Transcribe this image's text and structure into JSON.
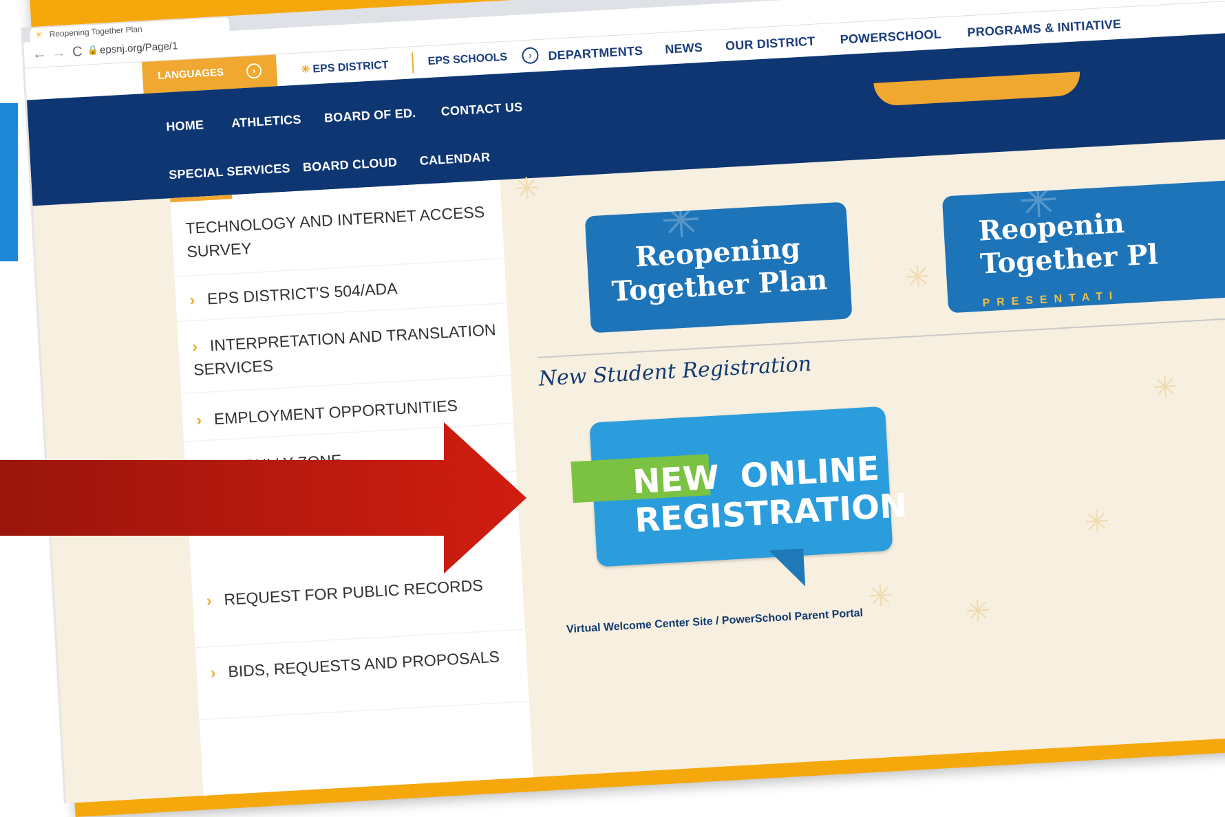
{
  "browser": {
    "tab_title": "Reopening Together Plan",
    "url": "epsnj.org/Page/1",
    "tab_icon": "star-icon"
  },
  "utility": {
    "languages": "LANGUAGES",
    "eps_district": "EPS DISTRICT",
    "eps_schools": "EPS SCHOOLS"
  },
  "nav": {
    "top": [
      "DEPARTMENTS",
      "NEWS",
      "OUR DISTRICT",
      "POWERSCHOOL",
      "PROGRAMS & INITIATIVE"
    ],
    "row1": [
      "HOME",
      "ATHLETICS",
      "BOARD OF ED.",
      "CONTACT US"
    ],
    "row2": [
      "SPECIAL SERVICES",
      "BOARD CLOUD",
      "CALENDAR"
    ]
  },
  "sidebar": {
    "items": [
      {
        "label": "TECHNOLOGY AND INTERNET ACCESS SURVEY",
        "arrow": false
      },
      {
        "label": "EPS DISTRICT'S 504/ADA",
        "arrow": true
      },
      {
        "label": "INTERPRETATION AND TRANSLATION SERVICES",
        "arrow": true
      },
      {
        "label": "EMPLOYMENT OPPORTUNITIES",
        "arrow": true
      },
      {
        "label": "NO BULLY ZONE",
        "arrow": true
      },
      {
        "label": "REQUEST FOR PUBLIC RECORDS",
        "arrow": true
      },
      {
        "label": "BIDS, REQUESTS AND PROPOSALS",
        "arrow": true
      }
    ]
  },
  "content": {
    "plan_card_1": "Reopening Together Plan",
    "plan_card_2_line1": "Reopenin",
    "plan_card_2_line2": "Together Pl",
    "plan_card_2_sub": "PRESENTATI",
    "new_registration_title": "New Student Registration",
    "banner_new": "NEW",
    "banner_online": "ONLINE",
    "banner_registration": "REGISTRATION",
    "footer_link": "Virtual Welcome Center Site / PowerSchool Parent Portal"
  },
  "colors": {
    "navy": "#0e3672",
    "orange": "#f5a80c",
    "banner_blue": "#2b9ddd",
    "arrow_red": "#c81d10"
  }
}
